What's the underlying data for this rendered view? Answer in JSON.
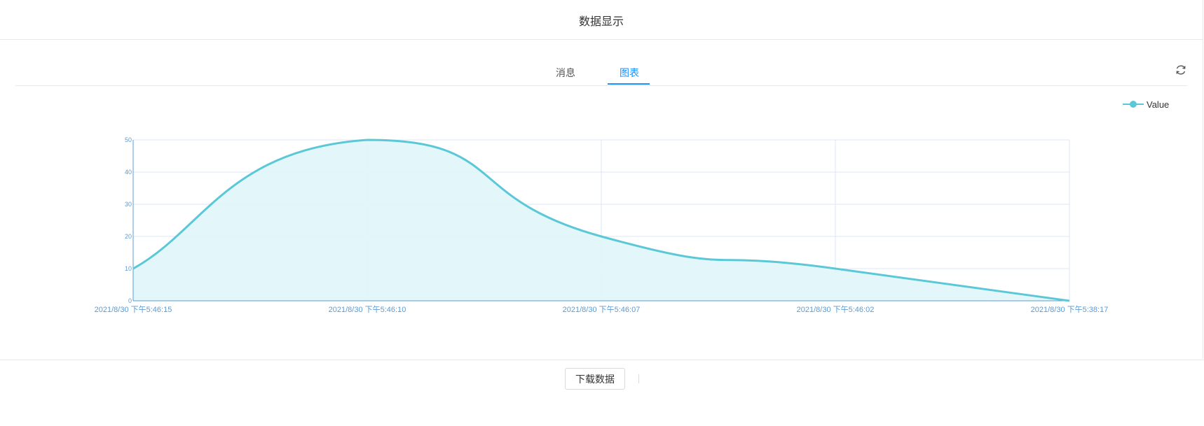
{
  "dialog": {
    "title": "数据显示"
  },
  "tabs": [
    {
      "label": "消息",
      "active": false
    },
    {
      "label": "图表",
      "active": true
    }
  ],
  "toolbar": {
    "refresh_icon": "refresh-icon"
  },
  "footer": {
    "download_label": "下载数据"
  },
  "colors": {
    "series": "#5bc8d8",
    "area": "#e0f6f9",
    "axis": "#5b9bd5",
    "grid": "#dde6f7",
    "accent": "#1890ff"
  },
  "chart_data": {
    "type": "area",
    "smooth": true,
    "x": [
      "2021/8/30 下午5:46:15",
      "2021/8/30 下午5:46:10",
      "2021/8/30 下午5:46:07",
      "2021/8/30 下午5:46:02",
      "2021/8/30 下午5:38:17"
    ],
    "series": [
      {
        "name": "Value",
        "values": [
          10,
          50,
          20,
          10,
          0
        ]
      }
    ],
    "ylim": [
      0,
      50
    ],
    "yticks": [
      "0",
      "10",
      "20",
      "30",
      "40",
      "50"
    ],
    "grid": true,
    "legend_position": "top-right"
  }
}
